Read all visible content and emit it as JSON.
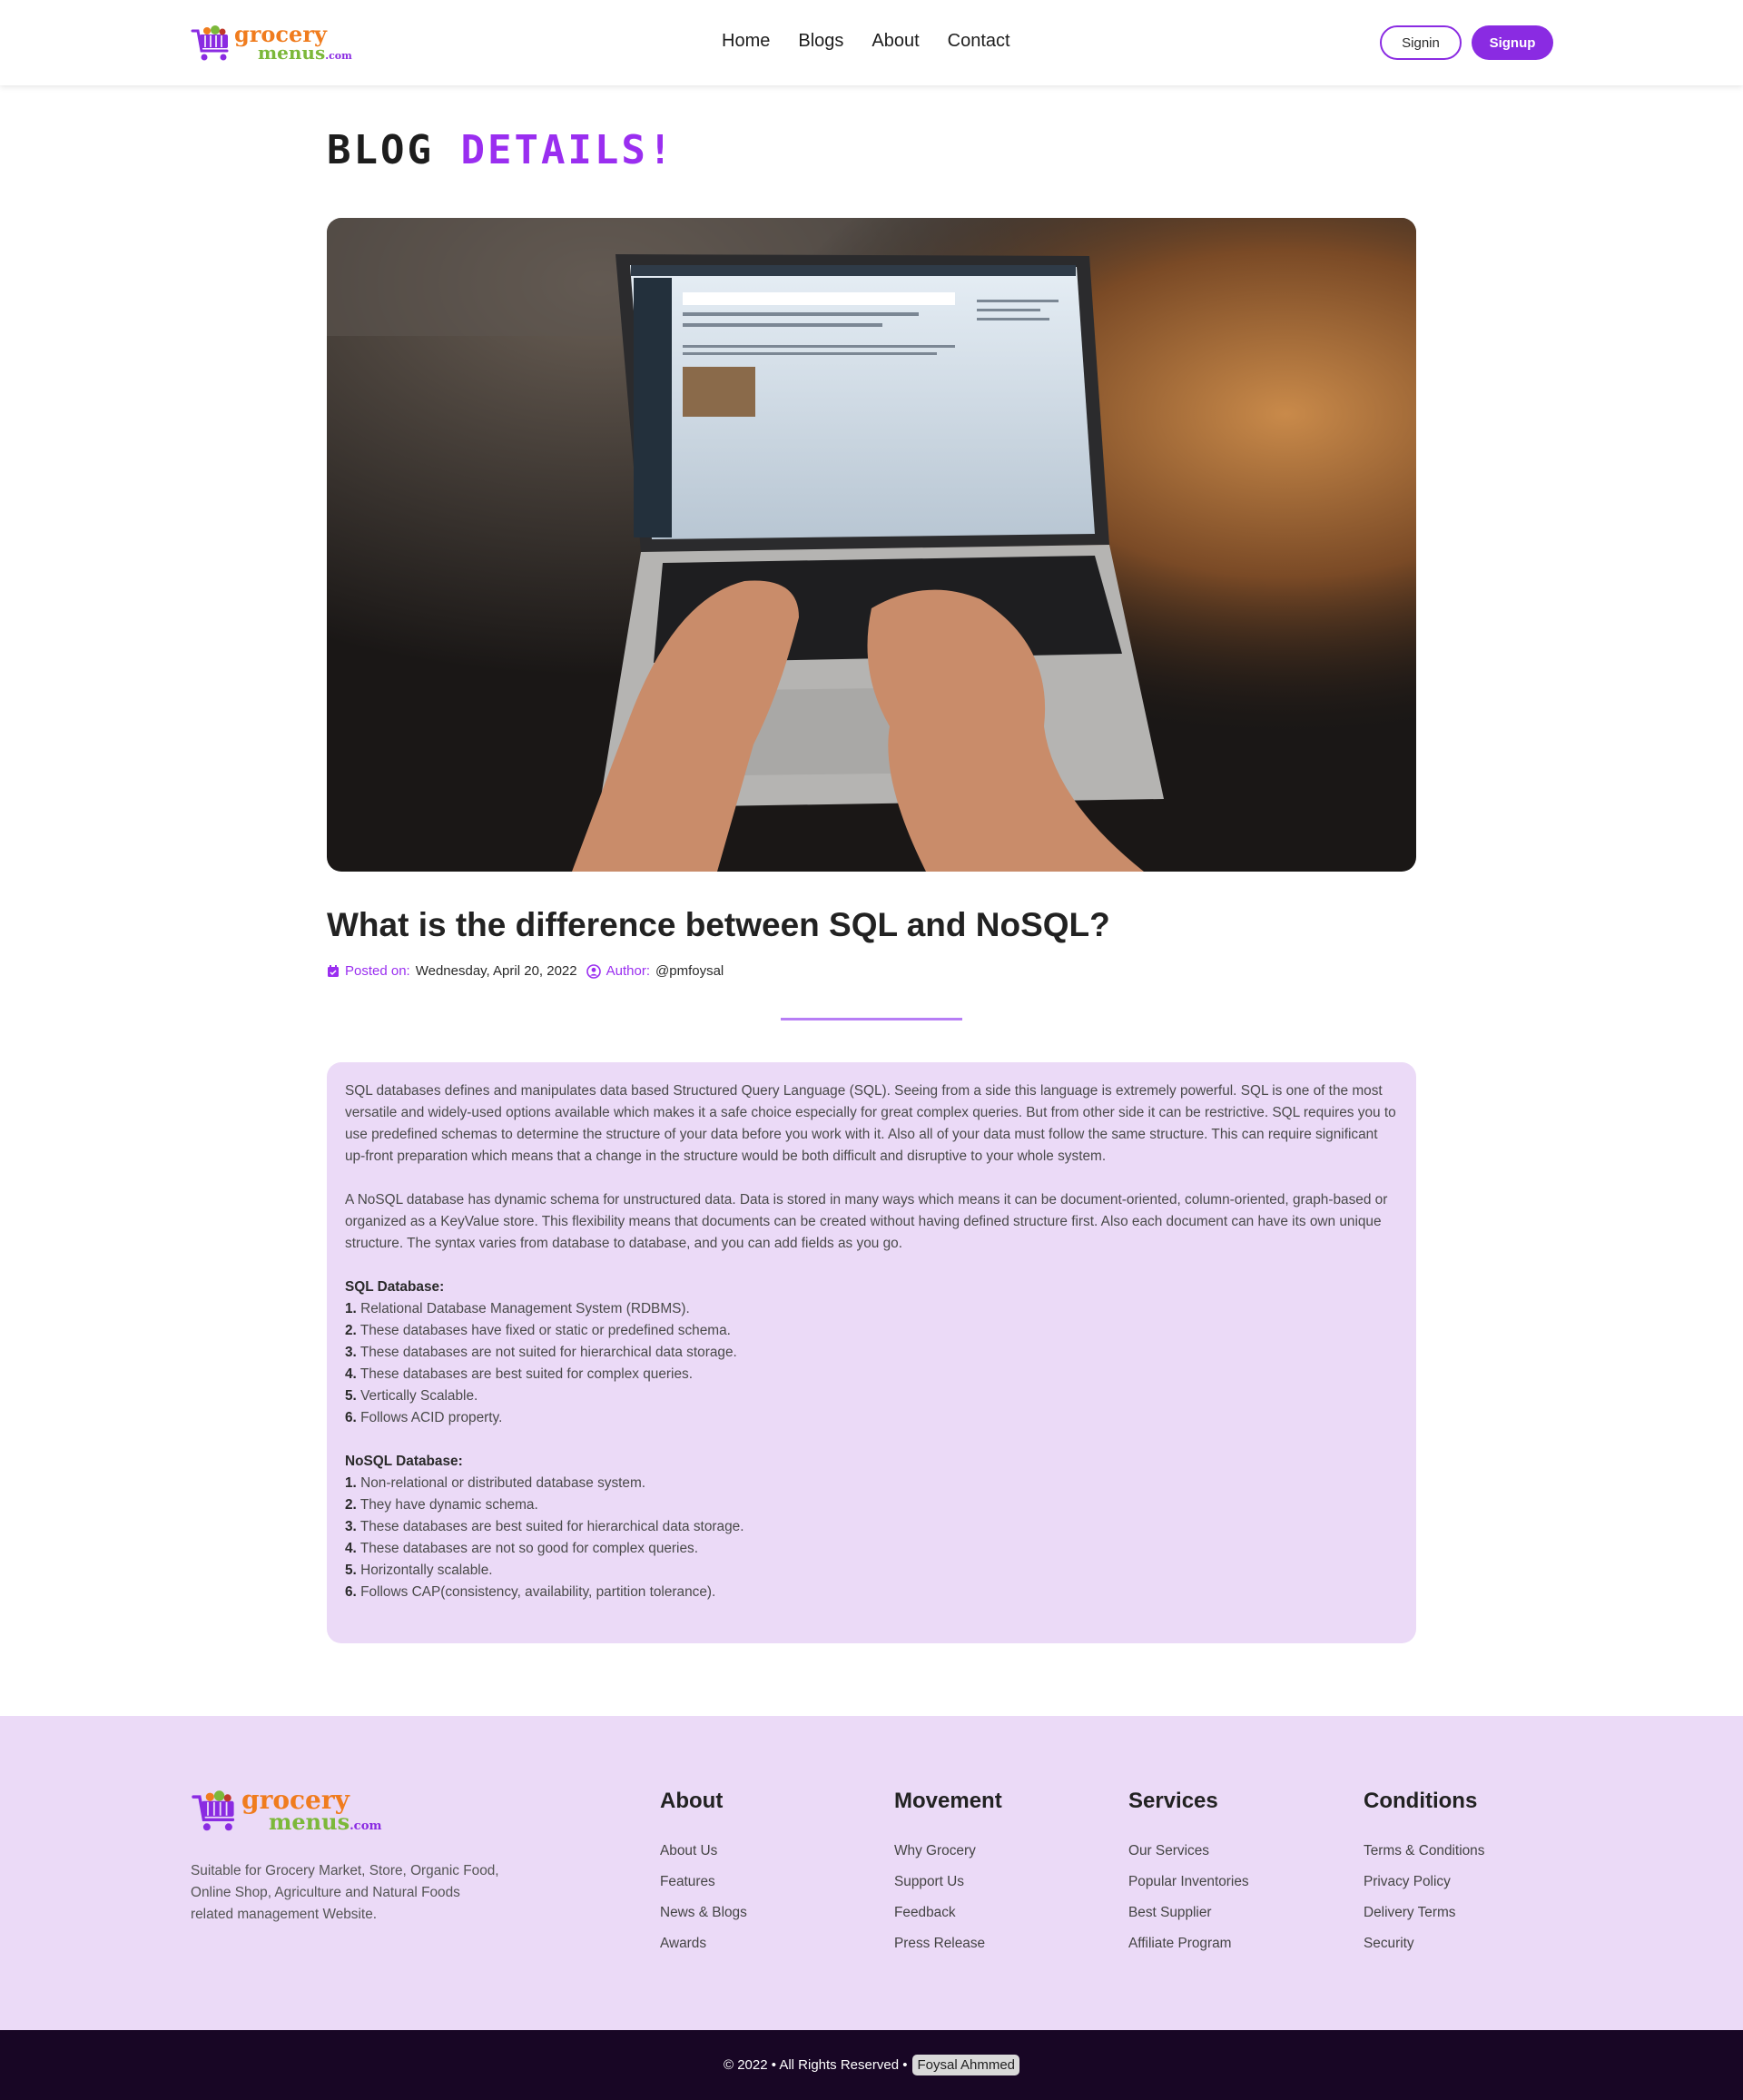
{
  "brand": {
    "logo_word1": "grocery",
    "logo_word2": "menus",
    "logo_suffix": ".com",
    "colors": {
      "primary": "#8a2be2",
      "orange": "#f07c1e",
      "green": "#7cb83a"
    }
  },
  "nav": {
    "items": [
      "Home",
      "Blogs",
      "About",
      "Contact"
    ],
    "signin": "Signin",
    "signup": "Signup"
  },
  "page_title": {
    "part1": "Blog",
    "part2": "Details!"
  },
  "hero": {
    "image_icon": "laptop-photo"
  },
  "post": {
    "title": "What is the difference between SQL and NoSQL?",
    "posted_label": "Posted on:",
    "posted_date": "Wednesday, April 20, 2022",
    "author_label": "Author:",
    "author": "@pmfoysal",
    "paragraphs": [
      "SQL databases defines and manipulates data based Structured Query Language (SQL). Seeing from a side this language is extremely powerful. SQL is one of the most versatile and widely-used options available which makes it a safe choice especially for great complex queries. But from other side it can be restrictive. SQL requires you to use predefined schemas to determine the structure of your data before you work with it. Also all of your data must follow the same structure. This can require significant up-front preparation which means that a change in the structure would be both difficult and disruptive to your whole system.",
      "A NoSQL database has dynamic schema for unstructured data. Data is stored in many ways which means it can be document-oriented, column-oriented, graph-based or organized as a KeyValue store. This flexibility means that documents can be created without having defined structure first. Also each document can have its own unique structure. The syntax varies from database to database, and you can add fields as you go."
    ],
    "sql_heading": "SQL Database:",
    "sql_items": [
      {
        "num": "1.",
        "text": "Relational Database Management System (RDBMS)."
      },
      {
        "num": "2.",
        "text": "These databases have fixed or static or predefined schema."
      },
      {
        "num": "3.",
        "text": "These databases are not suited for hierarchical data storage."
      },
      {
        "num": "4.",
        "text": "These databases are best suited for complex queries."
      },
      {
        "num": "5.",
        "text": "Vertically Scalable."
      },
      {
        "num": "6.",
        "text": "Follows ACID property."
      }
    ],
    "nosql_heading": "NoSQL Database:",
    "nosql_items": [
      {
        "num": "1.",
        "text": "Non-relational or distributed database system."
      },
      {
        "num": "2.",
        "text": "They have dynamic schema."
      },
      {
        "num": "3.",
        "text": "These databases are best suited for hierarchical data storage."
      },
      {
        "num": "4.",
        "text": "These databases are not so good for complex queries."
      },
      {
        "num": "5.",
        "text": "Horizontally scalable."
      },
      {
        "num": "6.",
        "text": "Follows CAP(consistency, availability, partition tolerance)."
      }
    ]
  },
  "footer": {
    "description": "Suitable for Grocery Market, Store, Organic Food, Online Shop, Agriculture and Natural Foods related management Website.",
    "columns": [
      {
        "title": "About",
        "links": [
          "About Us",
          "Features",
          "News & Blogs",
          "Awards"
        ]
      },
      {
        "title": "Movement",
        "links": [
          "Why Grocery",
          "Support Us",
          "Feedback",
          "Press Release"
        ]
      },
      {
        "title": "Services",
        "links": [
          "Our Services",
          "Popular Inventories",
          "Best Supplier",
          "Affiliate Program"
        ]
      },
      {
        "title": "Conditions",
        "links": [
          "Terms & Conditions",
          "Privacy Policy",
          "Delivery Terms",
          "Security"
        ]
      }
    ],
    "copyright": "© 2022 • All Rights Reserved •",
    "owner": "Foysal Ahmmed"
  }
}
